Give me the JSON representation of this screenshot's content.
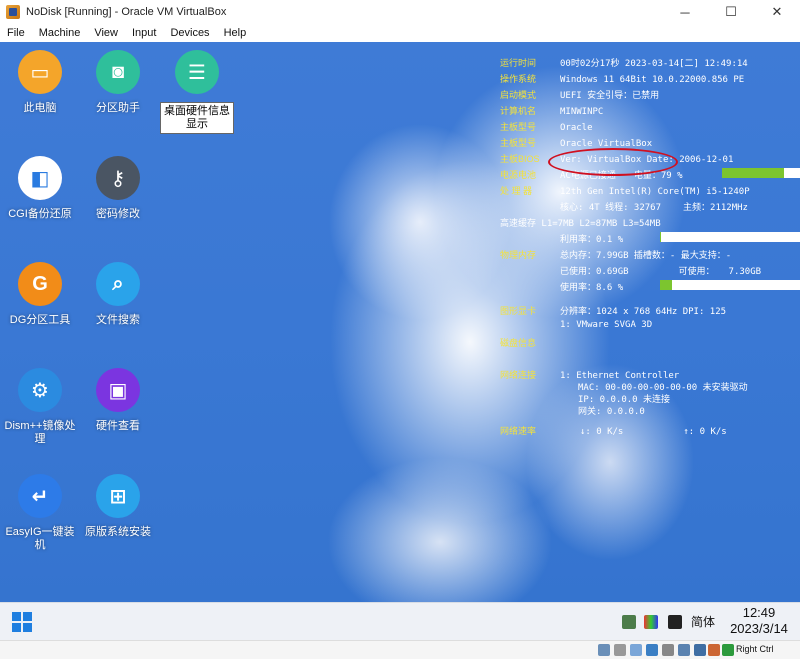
{
  "window": {
    "title": "NoDisk [Running] - Oracle VM VirtualBox",
    "minimize": "─",
    "maximize": "☐",
    "close": "✕"
  },
  "menu": [
    "File",
    "Machine",
    "View",
    "Input",
    "Devices",
    "Help"
  ],
  "desktop_icons": [
    {
      "label": "此电脑",
      "color": "#f4a52a",
      "glyph": "▭"
    },
    {
      "label": "分区助手",
      "color": "#2fbf9b",
      "glyph": "◙"
    },
    {
      "label": "桌面硬件信息显示",
      "color": "#2fbf9b",
      "glyph": "☰"
    },
    {
      "label": "CGI备份还原",
      "color": "#ffffff",
      "glyph": "◧"
    },
    {
      "label": "密码修改",
      "color": "#4a5563",
      "glyph": "⚷"
    },
    {
      "label": "DG分区工具",
      "color": "#f28c18",
      "glyph": "G"
    },
    {
      "label": "文件搜索",
      "color": "#2aa3ea",
      "glyph": "⌕"
    },
    {
      "label": "Dism++镜像处理",
      "color": "#2b8be0",
      "glyph": "⚙"
    },
    {
      "label": "硬件查看",
      "color": "#7b35e0",
      "glyph": "▣"
    },
    {
      "label": "EasyIG一键装机",
      "color": "#2d7be8",
      "glyph": "↵"
    },
    {
      "label": "原版系统安装",
      "color": "#2aa3ea",
      "glyph": "⊞"
    }
  ],
  "sysinfo": {
    "runtime_key": "运行时间",
    "runtime_val": "00时02分17秒  2023-03-14[二] 12:49:14",
    "os_key": "操作系统",
    "os_val": "Windows 11 64Bit 10.0.22000.856 PE",
    "boot_key": "启动模式",
    "boot_val": "UEFI         安全引导：已禁用",
    "pc_key": "计算机名",
    "pc_val": "MINWINPC",
    "mb_key": "主板型号",
    "mb_val": "Oracle",
    "brand_key": "主板型号",
    "brand_val": "Oracle VirtualBox",
    "bios_key": "主板BIOS",
    "bios_val": "Ver: VirtualBox  Date: 2006-12-01",
    "power_key": "电源电池",
    "power_val": "AC电源已接通",
    "power_pct_label": "电量：",
    "power_pct": "79 %",
    "power_level": 0.79,
    "cpu_key": "处 理 器",
    "cpu_val": "12th Gen Intel(R) Core(TM) i5-1240P",
    "cores_val": "核心: 4T  线程: 32767",
    "freq_label": "主频：",
    "freq_val": "2112MHz",
    "cache_val": "高速缓存  L1=7MB  L2=87MB  L3=54MB",
    "cpu_use_label": "利用率：",
    "cpu_use": "0.1 %",
    "cpu_level": 0.001,
    "mem_key": "物理内存",
    "mem_val": "总内存：7.99GB  插槽数：- 最大支持：-",
    "mem_used_label": "已使用：",
    "mem_used": "0.69GB",
    "mem_avail_label": "可使用：",
    "mem_avail": "7.30GB",
    "mem_rate_label": "使用率：",
    "mem_rate": "8.6 %",
    "mem_level": 0.086,
    "gpu_key": "图形显卡",
    "gpu_val": "分辨率：1024 x 768 64Hz  DPI: 125",
    "gpu_name": "1: VMware SVGA 3D",
    "disk_key": "磁盘信息",
    "net_key": "网络连接",
    "net_val": "1: Ethernet Controller",
    "mac_val": "MAC: 00-00-00-00-00-00 未安装驱动",
    "ip_val": "IP: 0.0.0.0 未连接",
    "gw_val": "网关: 0.0.0.0",
    "speed_key": "网络速率",
    "down_val": "↓: 0 K/s",
    "up_val": "↑: 0 K/s"
  },
  "taskbar": {
    "ime": "简体",
    "time": "12:49",
    "date": "2023/3/14"
  },
  "statusbar": {
    "host_key": "Right Ctrl"
  }
}
